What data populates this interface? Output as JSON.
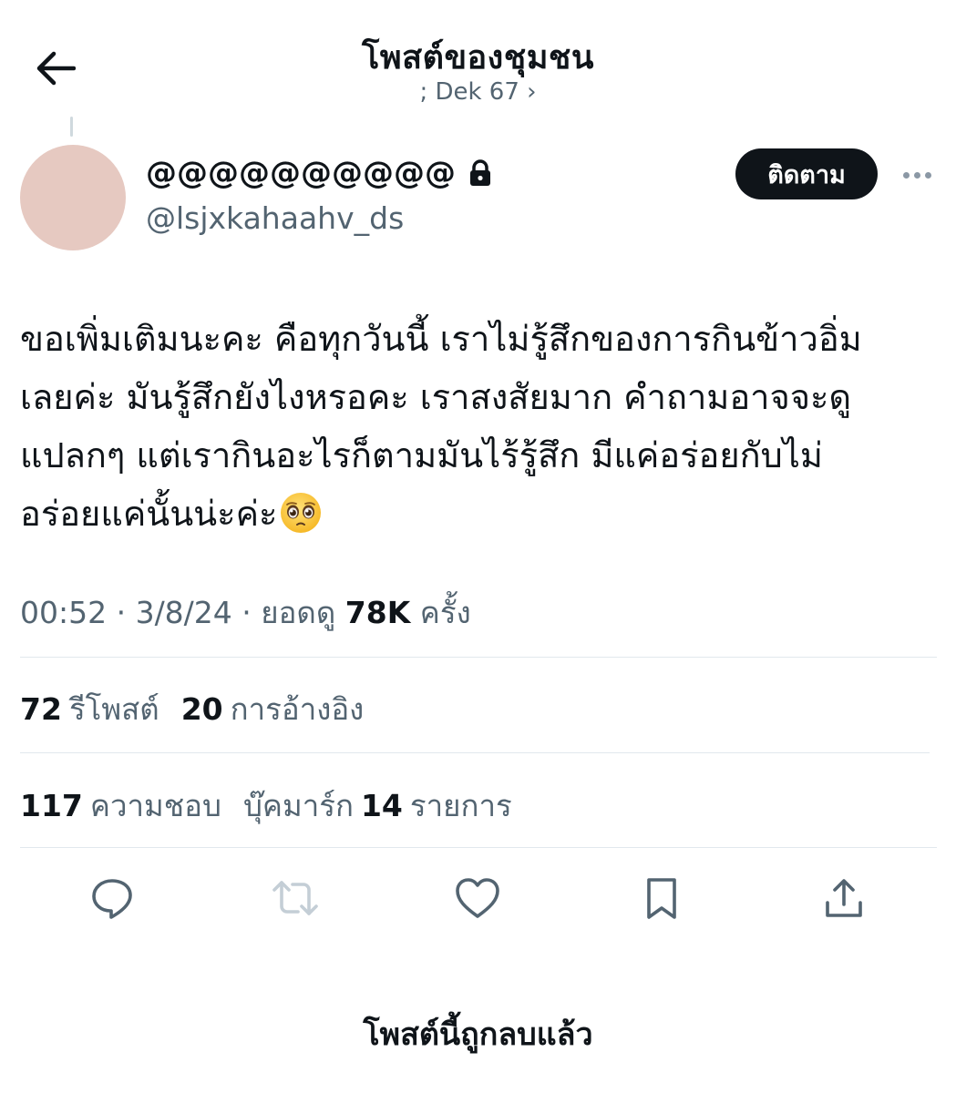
{
  "header": {
    "title": "โพสต์ของชุมชน",
    "community": "; Dek 67 ›"
  },
  "author": {
    "display_name": "@@@@@@@@@@",
    "handle": "@lsjxkahaahv_ds",
    "avatar_color": "#e6c9c1",
    "lock_icon": "lock-icon"
  },
  "actions_top": {
    "follow_label": "ติดตาม",
    "more_icon": "more-icon"
  },
  "post": {
    "text_lines": [
      "ขอเพิ่มเติมนะคะ คือทุกวันนี้ เราไม่รู้สึกของการกินข้าวอิ่ม",
      "เลยค่ะ มันรู้สึกยังไงหรอคะ เราสงสัยมาก คำถามอาจจะดู",
      "แปลกๆ แต่เรากินอะไรก็ตามมันไร้รู้สึก มีแค่อร่อยกับไม่",
      "อร่อยแค่นั้นน่ะค่ะ"
    ],
    "emoji": "pleading-face-emoji"
  },
  "meta": {
    "time_date": "00:52 · 3/8/24 · ยอดดู",
    "views": "78K",
    "views_unit": "ครั้ง"
  },
  "stats": {
    "reposts_count": "72",
    "reposts_label": "รีโพสต์",
    "quotes_count": "20",
    "quotes_label": "การอ้างอิง",
    "likes_count": "117",
    "likes_label": "ความชอบ",
    "bookmarks_label": "บุ๊คมาร์ก",
    "bookmarks_count": "14",
    "bookmarks_unit": "รายการ"
  },
  "action_bar": [
    {
      "icon": "reply-icon"
    },
    {
      "icon": "repost-icon"
    },
    {
      "icon": "like-icon"
    },
    {
      "icon": "bookmark-icon"
    },
    {
      "icon": "share-icon"
    }
  ],
  "footer": {
    "deleted_notice": "โพสต์นี้ถูกลบแล้ว"
  },
  "colors": {
    "text": "#0f1419",
    "secondary": "#536471",
    "follow_bg": "#0f1419",
    "divider": "#e1e8ed",
    "icon": "#536471",
    "disabled_icon": "#c4ced6"
  }
}
